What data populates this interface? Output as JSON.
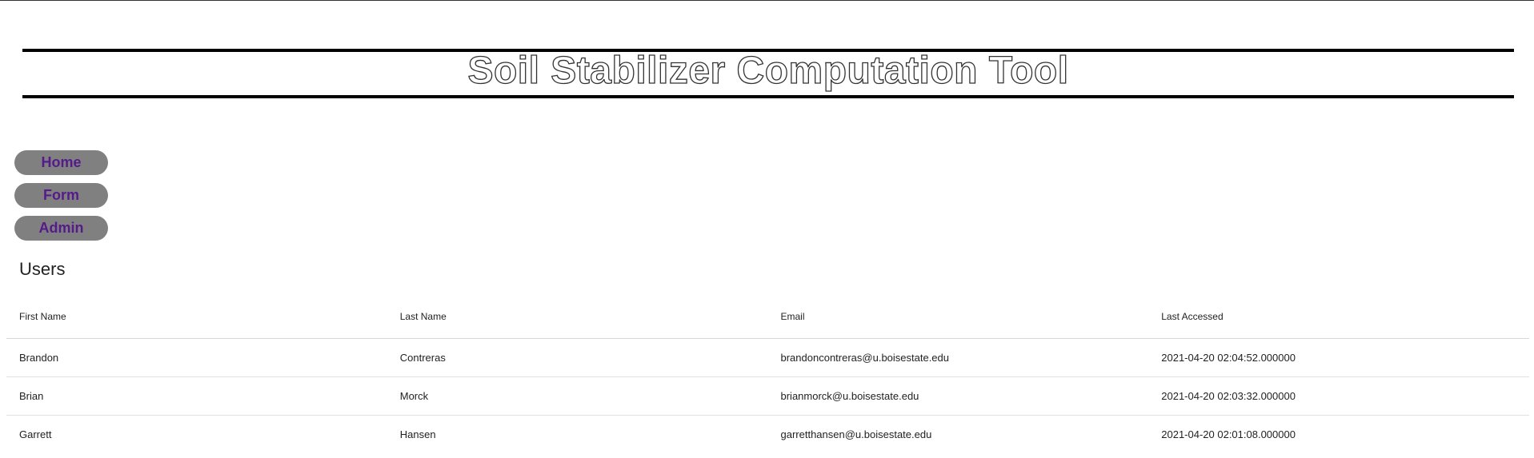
{
  "header": {
    "title": "Soil Stabilizer Computation Tool"
  },
  "nav": {
    "items": [
      {
        "label": "Home"
      },
      {
        "label": "Form"
      },
      {
        "label": "Admin"
      }
    ]
  },
  "users_section": {
    "title": "Users",
    "columns": [
      "First Name",
      "Last Name",
      "Email",
      "Last Accessed"
    ],
    "rows": [
      {
        "first_name": "Brandon",
        "last_name": "Contreras",
        "email": "brandoncontreras@u.boisestate.edu",
        "last_accessed": "2021-04-20 02:04:52.000000"
      },
      {
        "first_name": "Brian",
        "last_name": "Morck",
        "email": "brianmorck@u.boisestate.edu",
        "last_accessed": "2021-04-20 02:03:32.000000"
      },
      {
        "first_name": "Garrett",
        "last_name": "Hansen",
        "email": "garretthansen@u.boisestate.edu",
        "last_accessed": "2021-04-20 02:01:08.000000"
      }
    ]
  },
  "colors": {
    "nav_background": "#808080",
    "nav_text": "#551a8b",
    "banner_rule": "#000000"
  }
}
